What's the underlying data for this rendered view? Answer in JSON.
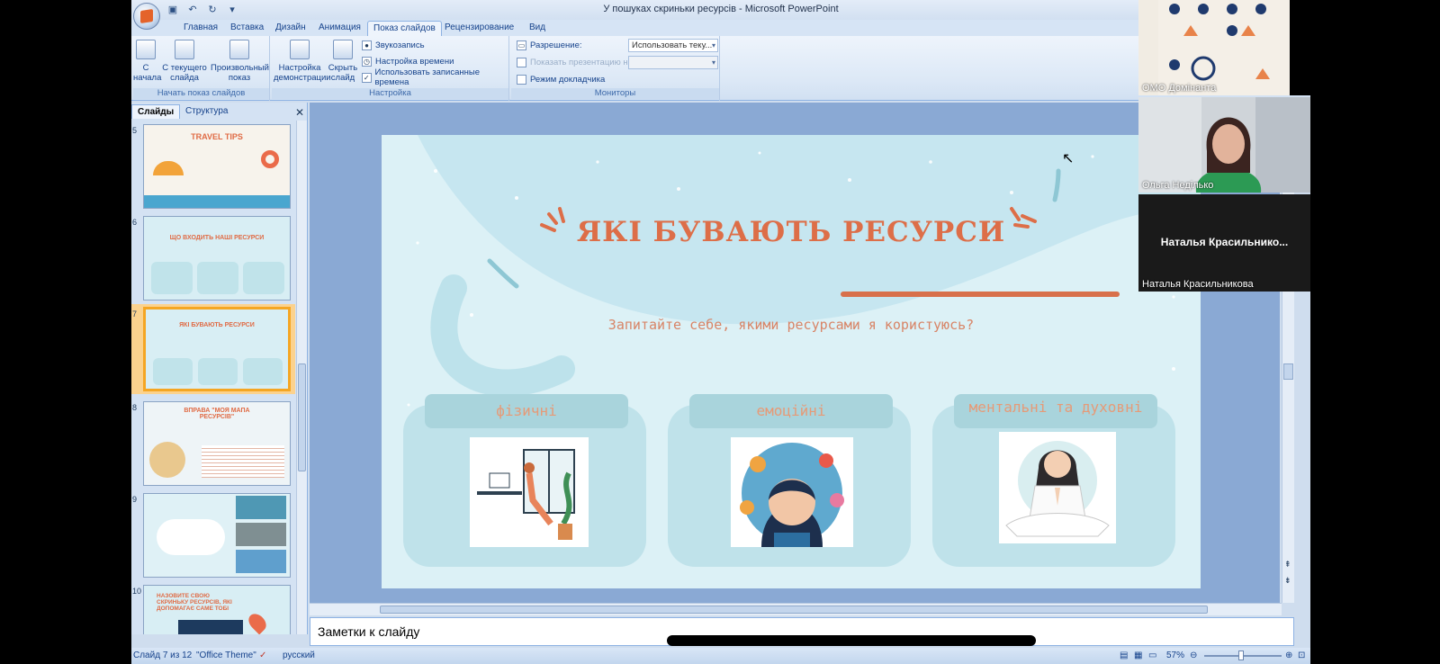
{
  "window": {
    "title": "У пошуках скриньки ресурсів - Microsoft PowerPoint"
  },
  "ribbon_tabs": [
    "Главная",
    "Вставка",
    "Дизайн",
    "Анимация",
    "Показ слайдов",
    "Рецензирование",
    "Вид"
  ],
  "ribbon": {
    "start_show": {
      "from_start": "С начала",
      "from_current": "С текущего слайда",
      "custom": "Произвольный показ",
      "group": "Начать показ слайдов"
    },
    "setup": {
      "setup_show": "Настройка демонстрации",
      "hide_slide": "Скрыть слайд",
      "record_narration": "Звукозапись",
      "rehearse_timings": "Настройка времени",
      "use_timings": "Использовать записанные времена",
      "group": "Настройка"
    },
    "monitors": {
      "resolution_label": "Разрешение:",
      "resolution_value": "Использовать теку...",
      "show_on_label": "Показать презентацию на:",
      "presenter_view": "Режим докладчика",
      "group": "Мониторы"
    }
  },
  "slides_pane": {
    "tab_slides": "Слайды",
    "tab_outline": "Структура",
    "thumbs": [
      {
        "num": "5",
        "title": "TRAVEL TIPS"
      },
      {
        "num": "6",
        "title": "ЩО ВХОДИТЬ НАШІ РЕСУРСИ"
      },
      {
        "num": "7",
        "title": "ЯКІ БУВАЮТЬ РЕСУРСИ"
      },
      {
        "num": "8",
        "title": "ВПРАВА \"МОЯ МАПА РЕСУРСІВ\""
      },
      {
        "num": "9",
        "title": ""
      },
      {
        "num": "10",
        "title": "НАЗОВИТЕ СВОЮ СКРИНЬКУ РЕСУРСІВ, ЯКІ ДОПОМАГАЄ САМЕ ТОБІ"
      }
    ]
  },
  "slide": {
    "title": "ЯКІ БУВАЮТЬ РЕСУРСИ",
    "subtitle": "Запитайте себе, якими ресурсами я користуюсь?",
    "cards": [
      {
        "label": "фізичні"
      },
      {
        "label": "емоційні"
      },
      {
        "label": "ментальні та духовні"
      }
    ]
  },
  "notes": {
    "placeholder": "Заметки к слайду"
  },
  "statusbar": {
    "slide_info": "Слайд 7 из 12",
    "theme": "\"Office Theme\"",
    "language": "русский",
    "zoom": "57%"
  },
  "call": {
    "participants": [
      {
        "name": "ОМО Домінанта"
      },
      {
        "name": "Ольга Неділько"
      },
      {
        "name": "Наталья  Красильнико...",
        "full_name": "Наталья Красильникова"
      }
    ]
  },
  "colors": {
    "accent": "#dd6e48",
    "slide_bg": "#dcf1f6",
    "card": "#bfe2ea",
    "ribbon": "#dce8f6"
  }
}
